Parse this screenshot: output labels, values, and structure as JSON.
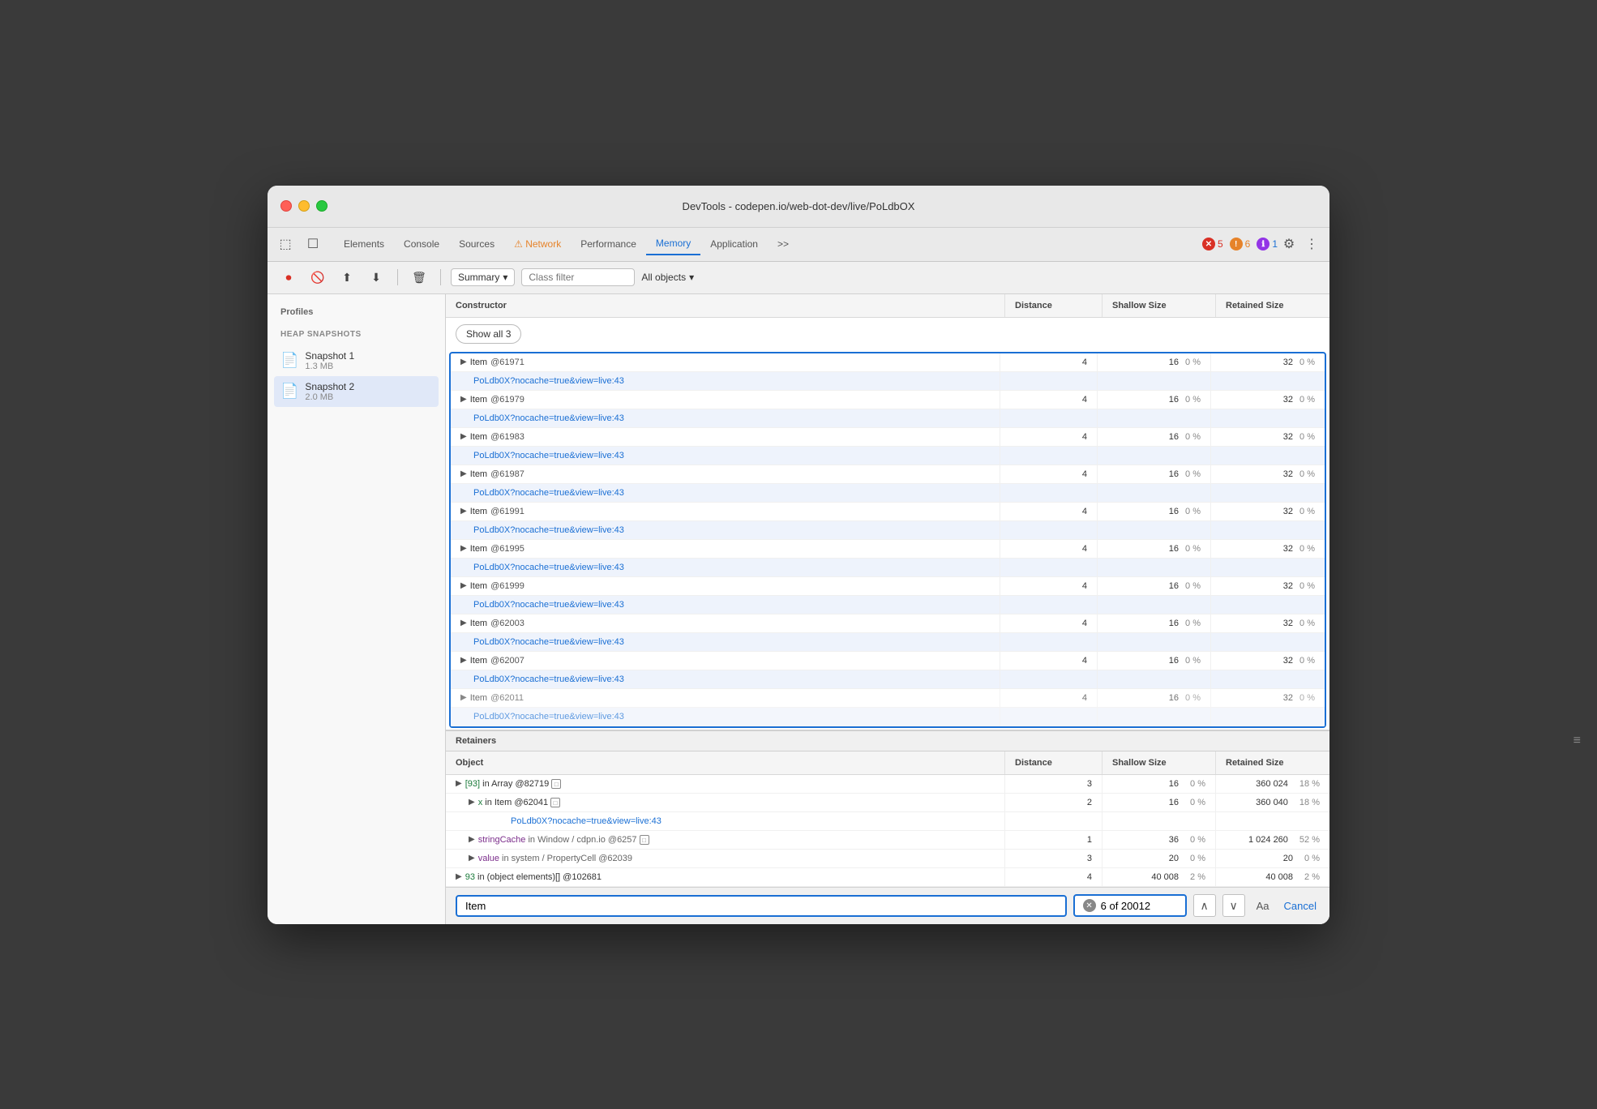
{
  "window": {
    "title": "DevTools - codepen.io/web-dot-dev/live/PoLdbOX"
  },
  "tabs": {
    "items": [
      {
        "label": "Elements",
        "active": false
      },
      {
        "label": "Console",
        "active": false
      },
      {
        "label": "Sources",
        "active": false
      },
      {
        "label": "Network",
        "active": false,
        "warning": true
      },
      {
        "label": "Performance",
        "active": false
      },
      {
        "label": "Memory",
        "active": true
      },
      {
        "label": "Application",
        "active": false
      }
    ],
    "more_label": ">>",
    "error_count": "5",
    "warning_count": "6",
    "info_count": "1"
  },
  "toolbar": {
    "summary_label": "Summary",
    "class_filter_placeholder": "Class filter",
    "objects_dropdown": "All objects"
  },
  "sidebar": {
    "profiles_label": "Profiles",
    "heap_snapshots_label": "HEAP SNAPSHOTS",
    "snapshots": [
      {
        "name": "Snapshot 1",
        "size": "1.3 MB"
      },
      {
        "name": "Snapshot 2",
        "size": "2.0 MB",
        "active": true
      }
    ]
  },
  "constructor_table": {
    "headers": [
      "Constructor",
      "Distance",
      "Shallow Size",
      "Retained Size"
    ],
    "show_all_label": "Show all 3",
    "rows": [
      {
        "name": "Item",
        "id": "@61971",
        "link": "PoLdb0X?nocache=true&view=live:43",
        "distance": "4",
        "shallow": "16",
        "shallow_pct": "0 %",
        "retained": "32",
        "retained_pct": "0 %"
      },
      {
        "name": "Item",
        "id": "@61979",
        "link": "PoLdb0X?nocache=true&view=live:43",
        "distance": "4",
        "shallow": "16",
        "shallow_pct": "0 %",
        "retained": "32",
        "retained_pct": "0 %"
      },
      {
        "name": "Item",
        "id": "@61983",
        "link": "PoLdb0X?nocache=true&view=live:43",
        "distance": "4",
        "shallow": "16",
        "shallow_pct": "0 %",
        "retained": "32",
        "retained_pct": "0 %"
      },
      {
        "name": "Item",
        "id": "@61987",
        "link": "PoLdb0X?nocache=true&view=live:43",
        "distance": "4",
        "shallow": "16",
        "shallow_pct": "0 %",
        "retained": "32",
        "retained_pct": "0 %"
      },
      {
        "name": "Item",
        "id": "@61991",
        "link": "PoLdb0X?nocache=true&view=live:43",
        "distance": "4",
        "shallow": "16",
        "shallow_pct": "0 %",
        "retained": "32",
        "retained_pct": "0 %"
      },
      {
        "name": "Item",
        "id": "@61995",
        "link": "PoLdb0X?nocache=true&view=live:43",
        "distance": "4",
        "shallow": "16",
        "shallow_pct": "0 %",
        "retained": "32",
        "retained_pct": "0 %"
      },
      {
        "name": "Item",
        "id": "@61999",
        "link": "PoLdb0X?nocache=true&view=live:43",
        "distance": "4",
        "shallow": "16",
        "shallow_pct": "0 %",
        "retained": "32",
        "retained_pct": "0 %"
      },
      {
        "name": "Item",
        "id": "@62003",
        "link": "PoLdb0X?nocache=true&view=live:43",
        "distance": "4",
        "shallow": "16",
        "shallow_pct": "0 %",
        "retained": "32",
        "retained_pct": "0 %"
      },
      {
        "name": "Item",
        "id": "@62007",
        "link": "PoLdb0X?nocache=true&view=live:43",
        "distance": "4",
        "shallow": "16",
        "shallow_pct": "0 %",
        "retained": "32",
        "retained_pct": "0 %"
      },
      {
        "name": "Item",
        "id": "@62011",
        "link": "PoLdb0X?nocache=true&view=live:43",
        "distance": "4",
        "shallow": "16",
        "shallow_pct": "0 %",
        "retained": "32",
        "retained_pct": "0 %"
      }
    ]
  },
  "retainers": {
    "label": "Retainers",
    "headers": [
      "Object",
      "Distance",
      "Shallow Size",
      "Retained Size"
    ],
    "rows": [
      {
        "type": "array_entry",
        "label": "[93] in Array @82719",
        "icon": "▶",
        "distance": "3",
        "shallow": "16",
        "shallow_pct": "0 %",
        "retained": "360 024",
        "retained_pct": "18 %",
        "indent": 1
      },
      {
        "type": "object_entry",
        "label": "x in Item @62041",
        "icon": "▶",
        "distance": "2",
        "shallow": "16",
        "shallow_pct": "0 %",
        "retained": "360 040",
        "retained_pct": "18 %",
        "indent": 2
      },
      {
        "type": "link",
        "label": "PoLdb0X?nocache=true&view=live:43",
        "indent": 3
      },
      {
        "type": "string_cache",
        "label": "stringCache in Window / cdpn.io @6257",
        "icon": "▶",
        "distance": "1",
        "shallow": "36",
        "shallow_pct": "0 %",
        "retained": "1 024 260",
        "retained_pct": "52 %",
        "indent": 2
      },
      {
        "type": "value",
        "label": "value in system / PropertyCell @62039",
        "icon": "▶",
        "distance": "3",
        "shallow": "20",
        "shallow_pct": "0 %",
        "retained": "20",
        "retained_pct": "0 %",
        "indent": 2
      },
      {
        "type": "elements",
        "label": "93 in (object elements)[] @102681",
        "icon": "▶",
        "distance": "4",
        "shallow": "40 008",
        "shallow_pct": "2 %",
        "retained": "40 008",
        "retained_pct": "2 %",
        "indent": 1
      }
    ]
  },
  "search": {
    "input_value": "Item",
    "result_text": "6 of 20012",
    "result_count": "20012",
    "aa_label": "Aa",
    "cancel_label": "Cancel"
  },
  "colors": {
    "accent_blue": "#1a6fd4",
    "selected_bg": "#d4e3f8"
  }
}
